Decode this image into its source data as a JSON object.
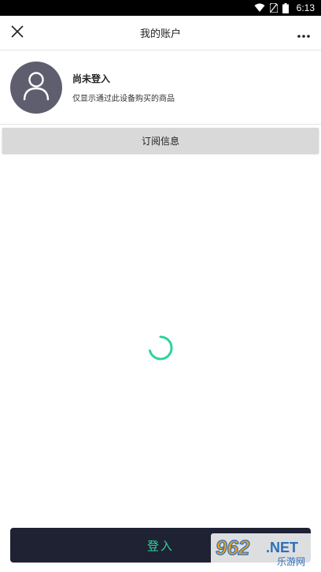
{
  "status_bar": {
    "time": "6:13",
    "icons": [
      "wifi-icon",
      "no-sim-icon",
      "battery-icon"
    ]
  },
  "header": {
    "title": "我的账户",
    "close_icon": "close-icon",
    "more_icon": "more-icon"
  },
  "profile": {
    "name": "尚未登入",
    "description": "仅显示通过此设备购买的商品",
    "avatar_icon": "user-icon"
  },
  "subscription": {
    "label": "订阅信息"
  },
  "loading": {
    "icon": "loading-spinner-icon"
  },
  "login": {
    "label": "登入"
  },
  "watermark": {
    "brand": "962",
    "suffix": ".NET",
    "subtitle": "乐游网"
  },
  "colors": {
    "status_bar_bg": "#000000",
    "avatar_bg": "#5e5e6e",
    "sub_bar_bg": "#d9d9d9",
    "login_bg": "#1f2233",
    "accent": "#2fd39a"
  }
}
